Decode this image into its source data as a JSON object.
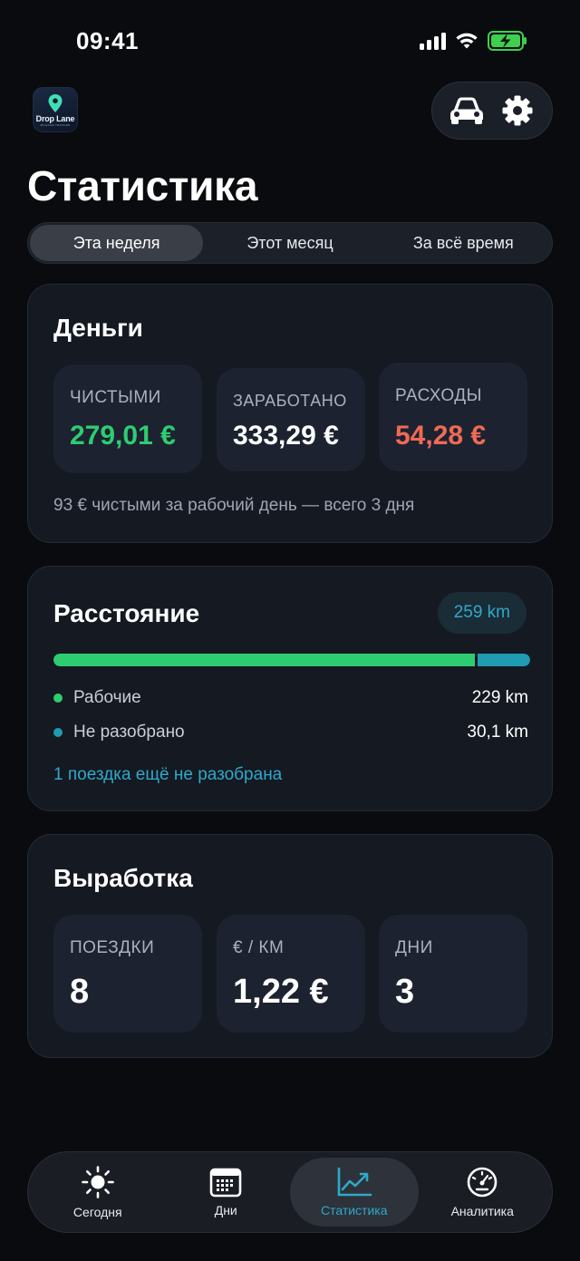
{
  "status": {
    "time": "09:41"
  },
  "app": {
    "logo_text": "Drop Lane",
    "logo_sub": "MILEAGE TRACKER"
  },
  "header": {
    "title": "Статистика"
  },
  "periods": [
    {
      "label": "Эта неделя",
      "active": true
    },
    {
      "label": "Этот месяц",
      "active": false
    },
    {
      "label": "За всё время",
      "active": false
    }
  ],
  "money": {
    "title": "Деньги",
    "net_label": "ЧИСТЫМИ",
    "net_value": "279,01 €",
    "earned_label": "ЗАРАБОТАНО",
    "earned_value": "333,29 €",
    "expenses_label": "РАСХОДЫ",
    "expenses_value": "54,28 €",
    "note": "93 € чистыми за рабочий день — всего 3 дня"
  },
  "distance": {
    "title": "Расстояние",
    "total_badge": "259 km",
    "work_share": 0.884,
    "work_label": "Рабочие",
    "work_value": "229 km",
    "unsorted_label": "Не разобрано",
    "unsorted_value": "30,1 km",
    "unsorted_note": "1 поездка ещё не разобрана"
  },
  "performance": {
    "title": "Выработка",
    "trips_label": "ПОЕЗДКИ",
    "trips_value": "8",
    "per_km_label": "€ / КМ",
    "per_km_value": "1,22 €",
    "days_label": "ДНИ",
    "days_value": "3"
  },
  "tabs": [
    {
      "label": "Сегодня",
      "icon": "sun-icon",
      "active": false
    },
    {
      "label": "Дни",
      "icon": "calendar-icon",
      "active": false
    },
    {
      "label": "Статистика",
      "icon": "chart-icon",
      "active": true
    },
    {
      "label": "Аналитика",
      "icon": "gauge-icon",
      "active": false
    }
  ],
  "colors": {
    "green": "#2ecc71",
    "red": "#ef6a55",
    "accent": "#2fa9c9",
    "teal": "#1f9bb2"
  }
}
